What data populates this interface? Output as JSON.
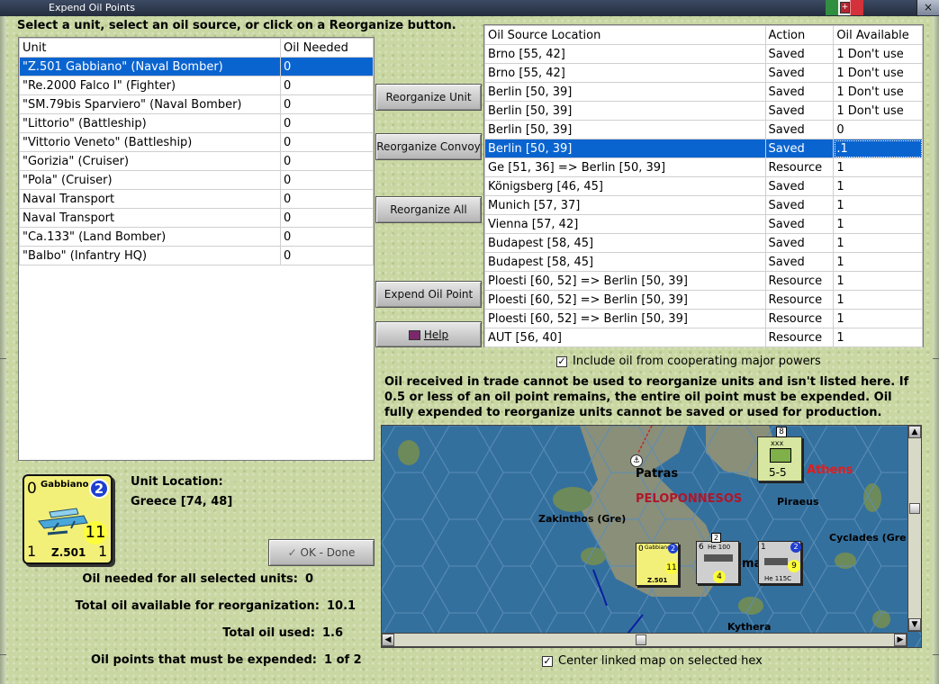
{
  "window": {
    "title": "Expend Oil Points",
    "close_label": "×"
  },
  "instruction": "Select a unit, select an oil source, or click on a Reorganize button.",
  "units_table": {
    "headers": [
      "Unit",
      "Oil Needed"
    ],
    "rows": [
      {
        "unit": "\"Z.501 Gabbiano\" (Naval Bomber)",
        "oil": "0"
      },
      {
        "unit": "\"Re.2000 Falco I\" (Fighter)",
        "oil": "0"
      },
      {
        "unit": "\"SM.79bis Sparviero\" (Naval Bomber)",
        "oil": "0"
      },
      {
        "unit": "\"Littorio\" (Battleship)",
        "oil": "0"
      },
      {
        "unit": "\"Vittorio Veneto\" (Battleship)",
        "oil": "0"
      },
      {
        "unit": "\"Gorizia\" (Cruiser)",
        "oil": "0"
      },
      {
        "unit": "\"Pola\" (Cruiser)",
        "oil": "0"
      },
      {
        "unit": "Naval Transport",
        "oil": "0"
      },
      {
        "unit": "Naval Transport",
        "oil": "0"
      },
      {
        "unit": "\"Ca.133\" (Land Bomber)",
        "oil": "0"
      },
      {
        "unit": "\"Balbo\" (Infantry HQ)",
        "oil": "0"
      }
    ]
  },
  "oil_sources_table": {
    "headers": [
      "Oil Source Location",
      "Action",
      "Oil Available"
    ],
    "rows": [
      {
        "loc": "Brno [55, 42]",
        "action": "Saved",
        "avail": "1 Don't use"
      },
      {
        "loc": "Brno [55, 42]",
        "action": "Saved",
        "avail": "1 Don't use"
      },
      {
        "loc": "Berlin [50, 39]",
        "action": "Saved",
        "avail": "1 Don't use"
      },
      {
        "loc": "Berlin [50, 39]",
        "action": "Saved",
        "avail": "1 Don't use"
      },
      {
        "loc": "Berlin [50, 39]",
        "action": "Saved",
        "avail": "0"
      },
      {
        "loc": "Berlin [50, 39]",
        "action": "Saved",
        "avail": ".1"
      },
      {
        "loc": "Ge [51, 36] => Berlin [50, 39]",
        "action": "Resource",
        "avail": "1"
      },
      {
        "loc": "Königsberg [46, 45]",
        "action": "Saved",
        "avail": "1"
      },
      {
        "loc": "Munich [57, 37]",
        "action": "Saved",
        "avail": "1"
      },
      {
        "loc": "Vienna [57, 42]",
        "action": "Saved",
        "avail": "1"
      },
      {
        "loc": "Budapest [58, 45]",
        "action": "Saved",
        "avail": "1"
      },
      {
        "loc": "Budapest [58, 45]",
        "action": "Saved",
        "avail": "1"
      },
      {
        "loc": "Ploesti [60, 52] => Berlin [50, 39]",
        "action": "Resource",
        "avail": "1"
      },
      {
        "loc": "Ploesti [60, 52] => Berlin [50, 39]",
        "action": "Resource",
        "avail": "1"
      },
      {
        "loc": "Ploesti [60, 52] => Berlin [50, 39]",
        "action": "Resource",
        "avail": "1"
      },
      {
        "loc": "AUT [56, 40]",
        "action": "Resource",
        "avail": "1"
      }
    ]
  },
  "buttons": {
    "reorganize_unit": "Reorganize Unit",
    "reorganize_convoy": "Reorganize Convoy",
    "reorganize_all": "Reorganize All",
    "expend_oil_point": "Expend Oil Point",
    "help": "Help",
    "ok_done": "OK - Done"
  },
  "include_coop": {
    "label": "Include oil from cooperating major powers",
    "checked": true
  },
  "center_map": {
    "label": "Center linked map on selected hex",
    "checked": true
  },
  "note": "Oil received in trade cannot be used to reorganize units and isn't listed here.  If 0.5 or less of an oil point remains, the entire oil point must be expended.   Oil fully expended to reorganize units cannot be saved or used for production.",
  "unit_counter": {
    "top_left": "0",
    "name": "Gabbiano",
    "badge": "2",
    "range": "11",
    "bottom_left": "1",
    "bottom_right": "1",
    "model": "Z.501"
  },
  "unit_location": {
    "label": "Unit Location:",
    "value": "Greece [74, 48]"
  },
  "stats": [
    {
      "label": "Oil needed for all selected units:",
      "value": "0"
    },
    {
      "label": "Total oil available for reorganization:",
      "value": "10.1"
    },
    {
      "label": "Total oil used:",
      "value": "1.6"
    },
    {
      "label": "Oil points that must be expended:",
      "value": "1 of 2"
    }
  ],
  "map": {
    "labels": {
      "patras": "Patras",
      "athens": "Athens",
      "peloponnesos": "PELOPONNESOS",
      "piraeus": "Piraeus",
      "zakinthos": "Zakinthos (Gre)",
      "cyclades": "Cyclades (Gre",
      "kythera": "Kythera",
      "ma": "ma"
    },
    "hq_counter": {
      "top": "8",
      "type": "xxx",
      "strength": "5-5"
    },
    "fighter_counter": {
      "top_left": "6",
      "name": "He 100",
      "badge": "2",
      "range": "4"
    },
    "bomber_counter": {
      "top_left": "1",
      "name": "He 115C",
      "badge": "2",
      "range": "9"
    },
    "mini_counter": {
      "top_left": "0",
      "name": "Gabbiano",
      "badge": "2",
      "range": "11",
      "model": "Z.501"
    }
  },
  "colors": {
    "selection": "#0a64d0",
    "sea": "#34709e",
    "land": "#8a8f7a",
    "athens": "#e21c1c",
    "counter_yellow": "#f3f079"
  }
}
